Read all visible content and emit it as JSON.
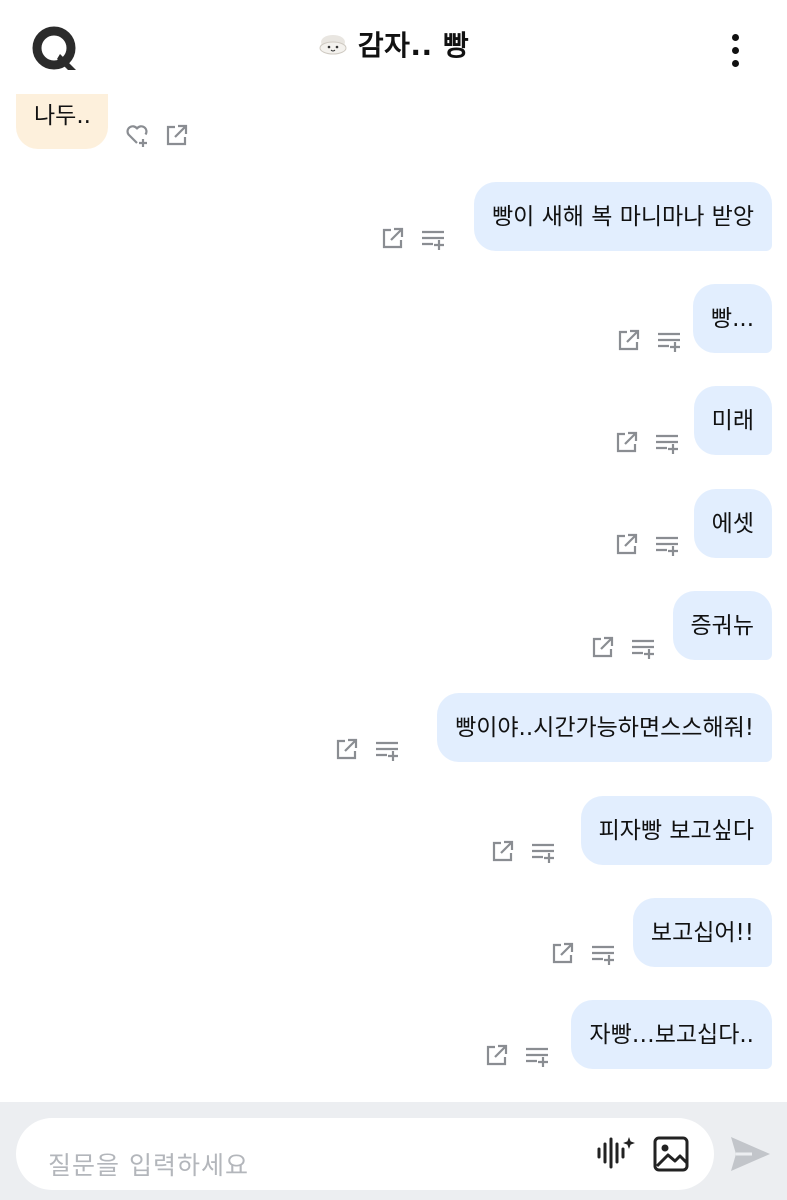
{
  "header": {
    "title": "감자.. 빵",
    "logo_icon": "q-logo-icon",
    "menu_icon": "kebab-menu-icon"
  },
  "messages": [
    {
      "role": "bot",
      "text": "나두.."
    },
    {
      "role": "user",
      "text": "빵이 새해 복 마니마나 받앙"
    },
    {
      "role": "user",
      "text": "빵..."
    },
    {
      "role": "user",
      "text": "미래"
    },
    {
      "role": "user",
      "text": "에셋"
    },
    {
      "role": "user",
      "text": "증궈뉴"
    },
    {
      "role": "user",
      "text": "빵이야..시간가능하면스스해줘!"
    },
    {
      "role": "user",
      "text": "피자빵 보고싶다"
    },
    {
      "role": "user",
      "text": "보고십어!!"
    },
    {
      "role": "user",
      "text": "자빵…보고십다.."
    }
  ],
  "composer": {
    "placeholder": "질문을 입력하세요",
    "voice_icon": "voice-sparkle-icon",
    "image_icon": "image-icon",
    "send_icon": "send-icon"
  },
  "colors": {
    "user_bubble": "#e2eefe",
    "bot_bubble": "#fdf0dc",
    "footer_bg": "#eceef1",
    "icon_gray": "#8a8d92"
  }
}
